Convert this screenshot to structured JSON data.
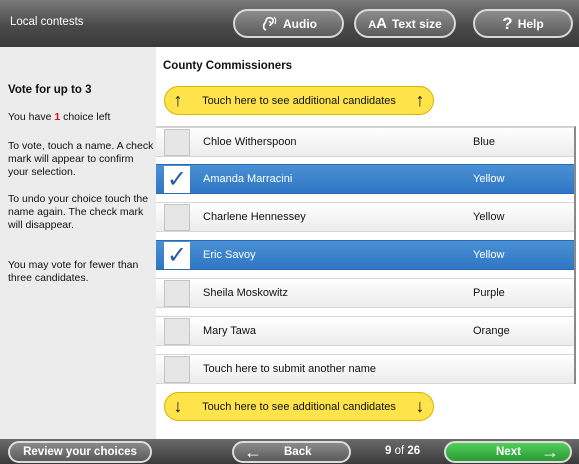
{
  "header": {
    "title": "Local contests",
    "audio_label": "Audio",
    "text_size_big": "A",
    "text_size_small": "A",
    "text_size_label": "Text size",
    "help_label": "Help"
  },
  "instructions": {
    "heading": "Vote for up to 3",
    "choices_prefix": "You have ",
    "choices_count": "1",
    "choices_suffix": " choice left",
    "to_vote": "To vote, touch a name. A check mark will appear to confirm your selection.",
    "to_undo": "To undo your choice touch the name again. The check mark will disappear.",
    "fewer": "You may vote for fewer than three candidates."
  },
  "contest": {
    "title": "County Commissioners",
    "scroll_up_label": "Touch here to see additional candidates",
    "scroll_down_label": "Touch here to see additional candidates",
    "candidates": [
      {
        "name": "Chloe Witherspoon",
        "party": "Blue",
        "selected": false
      },
      {
        "name": "Amanda Marracini",
        "party": "Yellow",
        "selected": true
      },
      {
        "name": "Charlene Hennessey",
        "party": "Yellow",
        "selected": false
      },
      {
        "name": "Eric Savoy",
        "party": "Yellow",
        "selected": true
      },
      {
        "name": "Sheila Moskowitz",
        "party": "Purple",
        "selected": false
      },
      {
        "name": "Mary Tawa",
        "party": "Orange",
        "selected": false
      }
    ],
    "write_in_label": "Touch here to submit another name"
  },
  "footer": {
    "review_label": "Review your choices",
    "back_label": "Back",
    "page_current": "9",
    "page_of": " of ",
    "page_total": "26",
    "next_label": "Next"
  },
  "colors": {
    "selected_row": "#2f77c4",
    "scroll_button": "#ffe34a",
    "next_button": "#2a9a34",
    "choices_count": "#d2101a"
  }
}
